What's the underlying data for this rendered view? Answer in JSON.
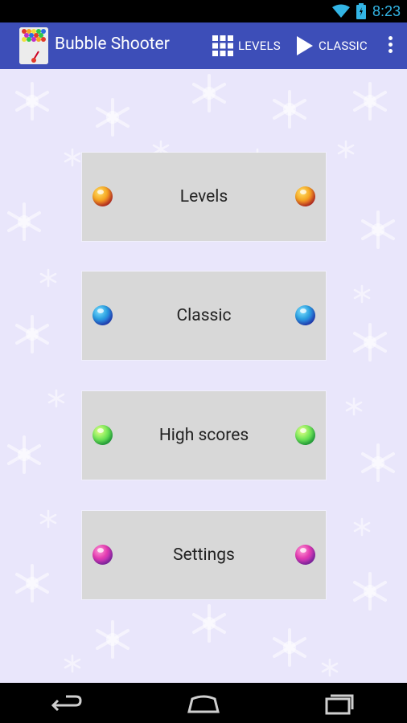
{
  "status_bar": {
    "time": "8:23"
  },
  "action_bar": {
    "title": "Bubble Shooter",
    "levels_label": "LEVELS",
    "classic_label": "CLASSIC"
  },
  "menu": [
    {
      "label": "Levels",
      "bubble_color": "#e33b2b"
    },
    {
      "label": "Classic",
      "bubble_color": "#2b6fe0"
    },
    {
      "label": "High scores",
      "bubble_color": "#2fc94a"
    },
    {
      "label": "Settings",
      "bubble_color": "#c02fc9"
    }
  ],
  "colors": {
    "action_bar": "#3d4eb8",
    "background": "#e9e6fb",
    "button": "#d8d8d8",
    "status_accent": "#33b5e5"
  }
}
